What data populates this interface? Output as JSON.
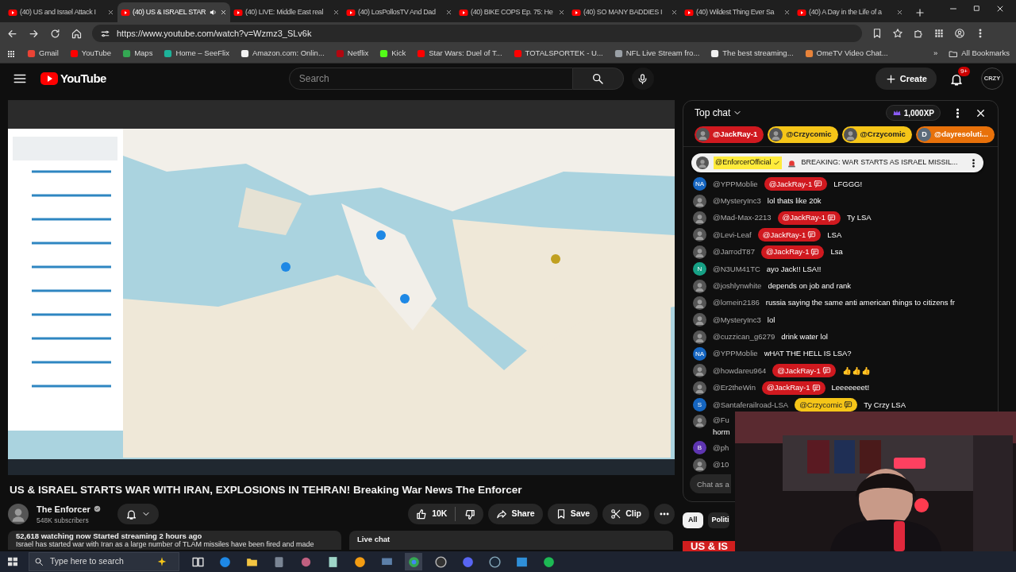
{
  "browser": {
    "tabs": [
      {
        "title": "(40) US and Israel Attack I",
        "selected": false,
        "audio": false
      },
      {
        "title": "(40) US & ISRAEL STAR",
        "selected": true,
        "audio": true
      },
      {
        "title": "(40) LIVE: Middle East real",
        "selected": false,
        "audio": false
      },
      {
        "title": "(40) LosPollosTV And Dad",
        "selected": false,
        "audio": false
      },
      {
        "title": "(40) BIKE COPS Ep. 75: He",
        "selected": false,
        "audio": false
      },
      {
        "title": "(40) SO MANY BADDIES I",
        "selected": false,
        "audio": false
      },
      {
        "title": "(40) Wildest Thing Ever Sa",
        "selected": false,
        "audio": false
      },
      {
        "title": "(40) A Day in the Life of a",
        "selected": false,
        "audio": false
      }
    ],
    "address": "https://www.youtube.com/watch?v=Wzmz3_SLv6k",
    "bookmarks": [
      {
        "label": "Gmail",
        "color": "#ea4335"
      },
      {
        "label": "YouTube",
        "color": "#ff0000"
      },
      {
        "label": "Maps",
        "color": "#34a853"
      },
      {
        "label": "Home – SeeFlix",
        "color": "#1db39a"
      },
      {
        "label": "Amazon.com: Onlin...",
        "color": "#f3f3f3"
      },
      {
        "label": "Netflix",
        "color": "#b20710"
      },
      {
        "label": "Kick",
        "color": "#53fc18"
      },
      {
        "label": "Star Wars: Duel of T...",
        "color": "#ff0000"
      },
      {
        "label": "TOTALSPORTEK - U...",
        "color": "#ff0000"
      },
      {
        "label": "NFL Live Stream fro...",
        "color": "#9aa0a6"
      },
      {
        "label": "The best streaming...",
        "color": "#f1f1f1"
      },
      {
        "label": "OmeTV Video Chat...",
        "color": "#e8833a"
      }
    ],
    "bookmarks_overflow": "»",
    "all_bookmarks": "All Bookmarks"
  },
  "youtube": {
    "logo": "YouTube",
    "search_placeholder": "Search",
    "create": "Create",
    "notifications": "9+",
    "avatar": "CRZY"
  },
  "video": {
    "title": "US & ISRAEL STARTS WAR WITH IRAN, EXPLOSIONS IN TEHRAN! Breaking War News The Enforcer",
    "channel": "The Enforcer",
    "verified": true,
    "subscribers": "548K subscribers",
    "likes": "10K",
    "actions": [
      "Share",
      "Save",
      "Clip"
    ],
    "stats": "52,618 watching now  Started streaming 2 hours ago",
    "description": "Israel has started war with Iran as a large number of TLAM missiles have been fired and made",
    "live_chat_label": "Live chat"
  },
  "chat": {
    "title": "Top chat",
    "xp": "1,000XP",
    "tickers": [
      {
        "name": "@JackRay-1",
        "color": "#d0191f",
        "kind": "picture"
      },
      {
        "name": "@Crzycomic",
        "color": "#f5c518",
        "kind": "picture"
      },
      {
        "name": "@Crzycomic",
        "color": "#f5c518",
        "kind": "picture"
      },
      {
        "name": "@dayresoluti...",
        "color": "#e8710a",
        "kind": "letter",
        "avatar": "D"
      }
    ],
    "pinned": {
      "author": "@EnforcerOfficial",
      "verified": true,
      "text": "BREAKING: WAR STARTS AS ISRAEL MISSIL..."
    },
    "messages": [
      {
        "kind": "letter",
        "avatar": "NA",
        "color": "#1565c0",
        "author": "@YPPMoblie",
        "mention": {
          "name": "@JackRay-1",
          "color": "#d0191f"
        },
        "text": "LFGGG!"
      },
      {
        "kind": "picture",
        "author": "@MysteryInc3",
        "text": "lol thats like 20k"
      },
      {
        "kind": "picture",
        "author": "@Mad-Max-2213",
        "mention": {
          "name": "@JackRay-1",
          "color": "#d0191f"
        },
        "text": "Ty LSA"
      },
      {
        "kind": "picture",
        "author": "@Levi-Leaf",
        "mention": {
          "name": "@JackRay-1",
          "color": "#d0191f"
        },
        "text": "LSA"
      },
      {
        "kind": "picture",
        "author": "@JarrodT87",
        "mention": {
          "name": "@JackRay-1",
          "color": "#d0191f"
        },
        "text": "Lsa"
      },
      {
        "kind": "letter",
        "avatar": "N",
        "color": "#16a085",
        "author": "@N3UM41TC",
        "text": "ayo Jack!! LSA!!"
      },
      {
        "kind": "picture",
        "author": "@joshlynwhite",
        "text": "depends on job and rank"
      },
      {
        "kind": "picture",
        "author": "@lomein2186",
        "text": "russia saying the same anti american things to citizens fr"
      },
      {
        "kind": "picture",
        "author": "@MysteryInc3",
        "text": "lol"
      },
      {
        "kind": "picture",
        "author": "@cuzzican_g6279",
        "text": "drink water lol"
      },
      {
        "kind": "letter",
        "avatar": "NA",
        "color": "#1565c0",
        "author": "@YPPMoblie",
        "text": "wHAT THE HELL IS LSA?"
      },
      {
        "kind": "picture",
        "author": "@howdareu964",
        "mention": {
          "name": "@JackRay-1",
          "color": "#d0191f"
        },
        "text": "👍👍👍"
      },
      {
        "kind": "picture",
        "author": "@Er2theWin",
        "mention": {
          "name": "@JackRay-1",
          "color": "#d0191f"
        },
        "text": "Leeeeeeet!"
      },
      {
        "kind": "letter",
        "avatar": "S",
        "color": "#1565c0",
        "author": "@Santaferailroad-LSA",
        "mention": {
          "name": "@Crzycomic",
          "color": "#f5c518"
        },
        "text": "Ty Crzy LSA"
      },
      {
        "kind": "picture",
        "author": "@Fu",
        "text": "horm",
        "wrapped": true
      },
      {
        "kind": "letter",
        "avatar": "B",
        "color": "#5e35b1",
        "author": "@ph"
      },
      {
        "kind": "picture",
        "author": "@10"
      }
    ],
    "placeholder": "Chat as a"
  },
  "chips": [
    {
      "label": "All",
      "selected": true
    },
    {
      "label": "Politi",
      "selected": false
    }
  ],
  "banner": "US & IS",
  "taskbar": {
    "search_placeholder": "Type here to search"
  }
}
